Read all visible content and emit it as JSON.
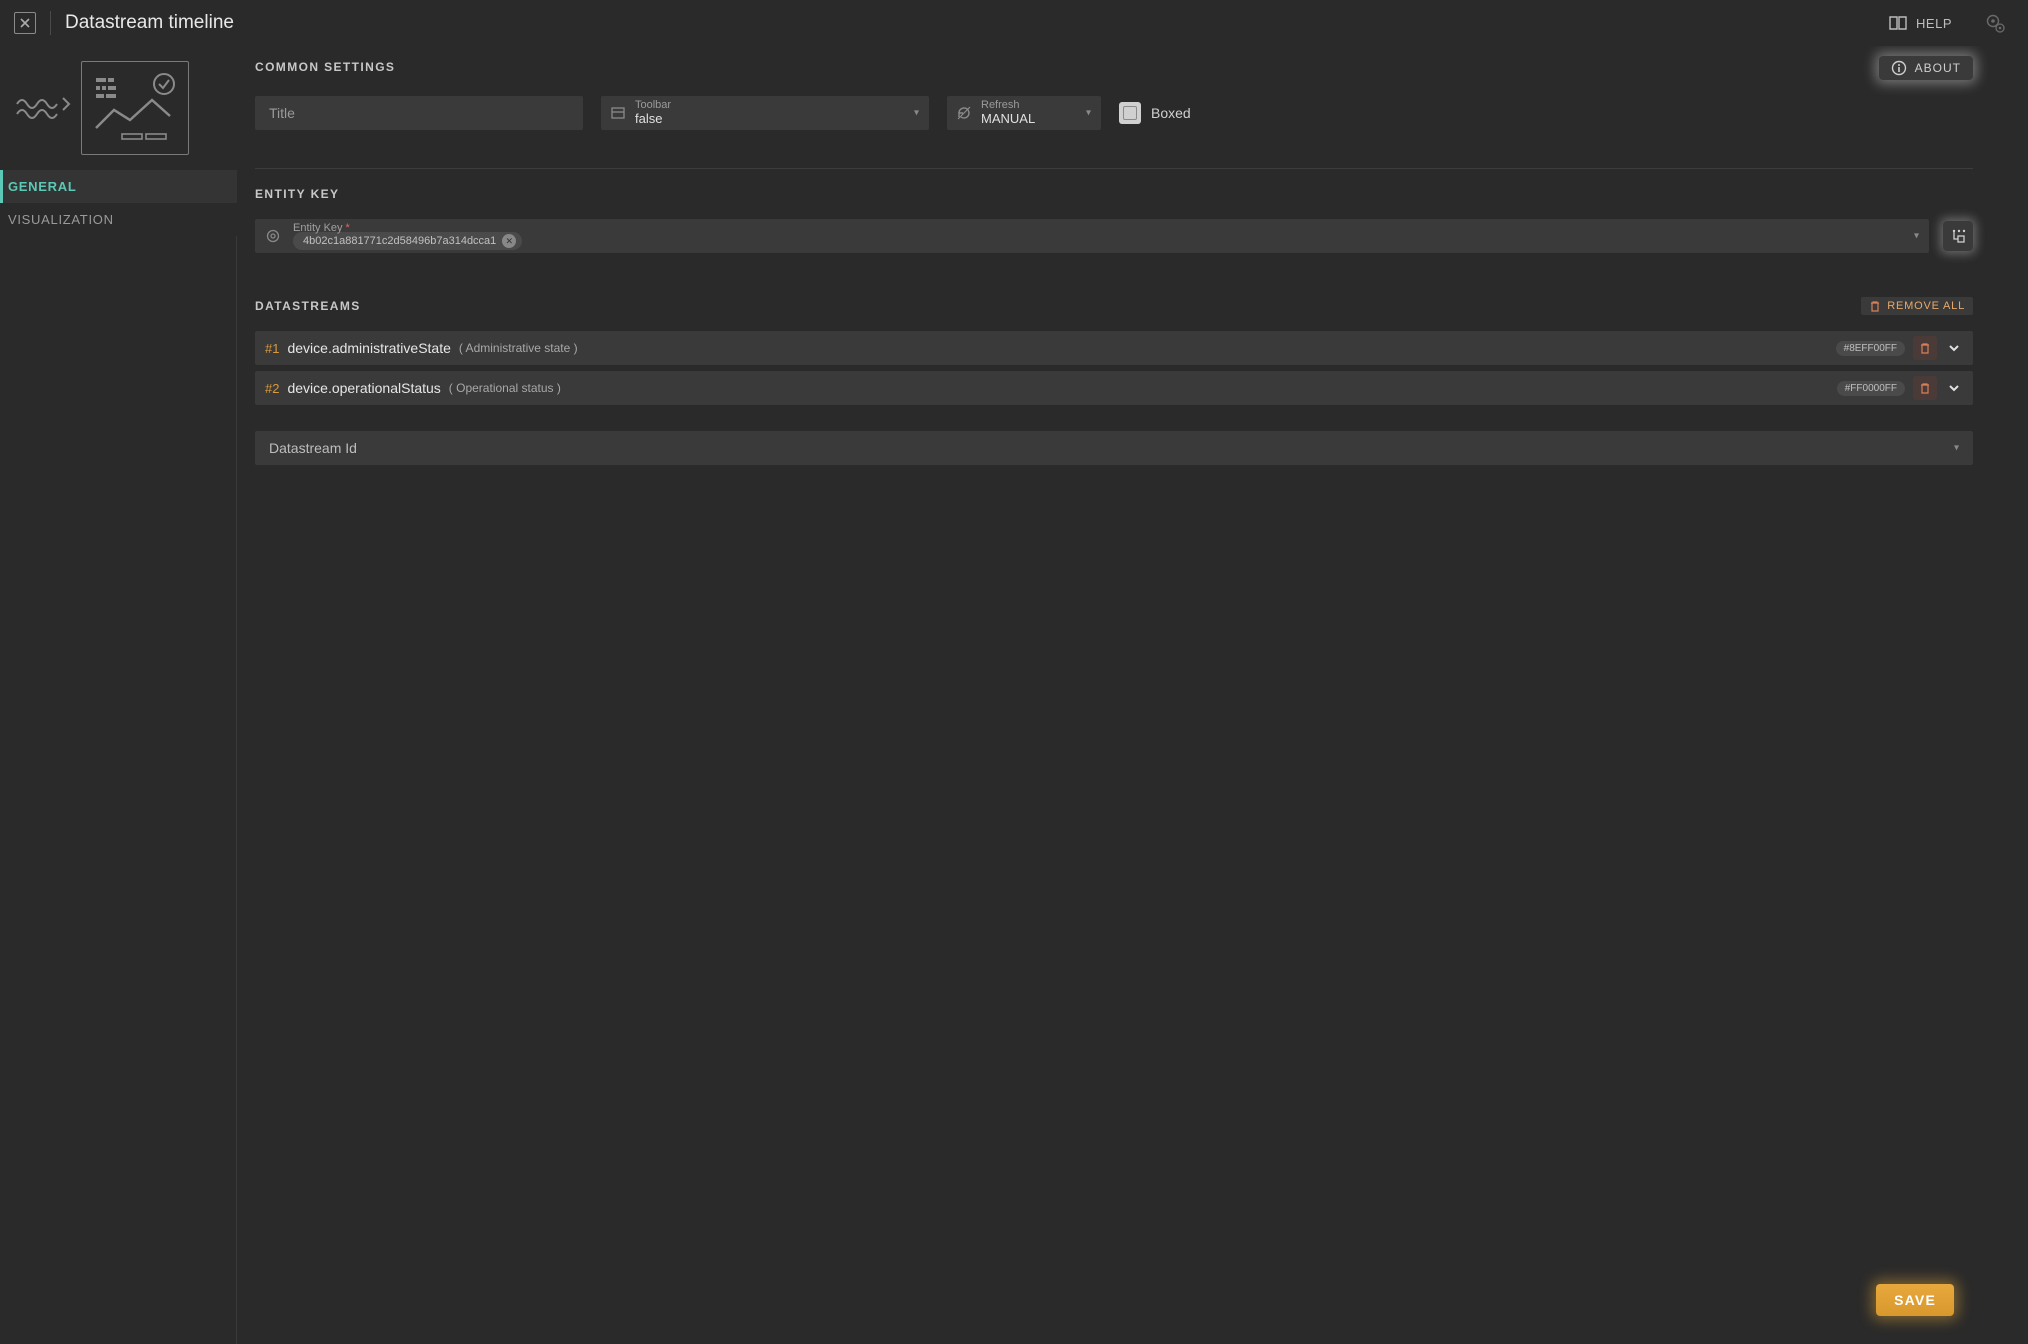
{
  "header": {
    "title": "Datastream timeline",
    "help": "HELP",
    "about": "ABOUT"
  },
  "sidebar": {
    "tabs": [
      {
        "label": "GENERAL",
        "active": true
      },
      {
        "label": "VISUALIZATION",
        "active": false
      }
    ]
  },
  "common": {
    "section": "COMMON SETTINGS",
    "title_placeholder": "Title",
    "title_value": "",
    "toolbar_label": "Toolbar",
    "toolbar_value": "false",
    "refresh_label": "Refresh",
    "refresh_value": "MANUAL",
    "boxed_label": "Boxed"
  },
  "entity": {
    "section": "ENTITY KEY",
    "field_label": "Entity Key",
    "chip": "4b02c1a881771c2d58496b7a314dcca1"
  },
  "datastreams": {
    "section": "DATASTREAMS",
    "remove_all": "REMOVE ALL",
    "rows": [
      {
        "idx": "#1",
        "name": "device.administrativeState",
        "desc": "( Administrative state )",
        "color": "#8EFF00FF"
      },
      {
        "idx": "#2",
        "name": "device.operationalStatus",
        "desc": "( Operational status )",
        "color": "#FF0000FF"
      }
    ],
    "id_placeholder": "Datastream Id"
  },
  "actions": {
    "save": "SAVE"
  }
}
